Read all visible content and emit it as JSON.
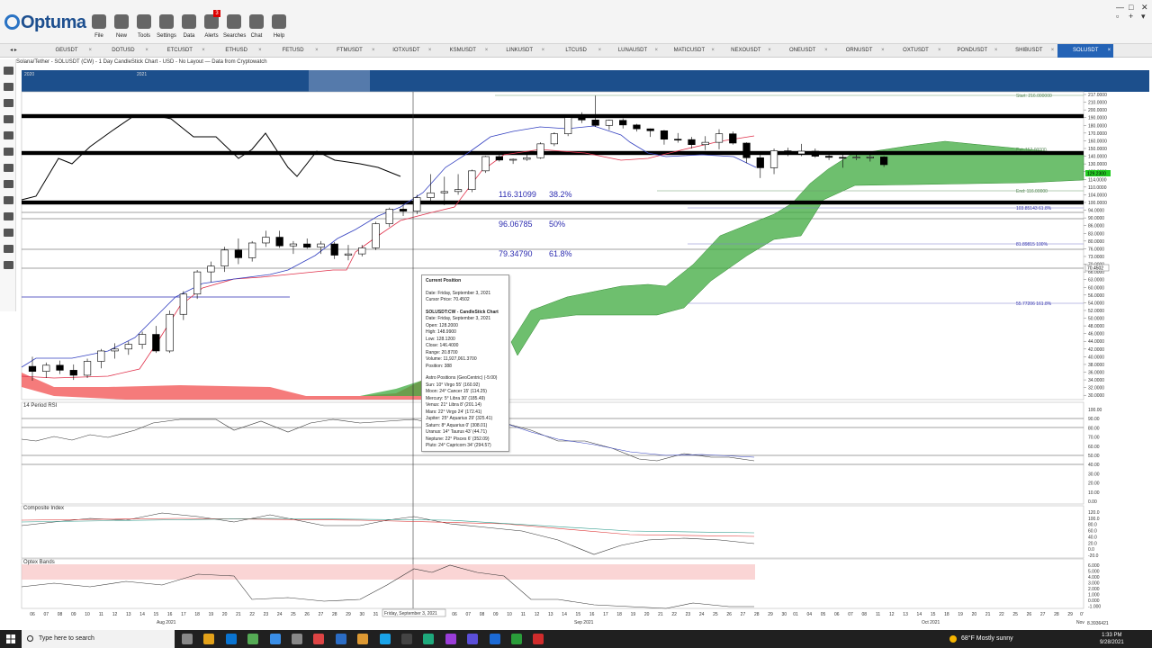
{
  "app": {
    "logo_text": "Optuma",
    "toolbar": [
      {
        "label": "File",
        "icon": "folder-icon"
      },
      {
        "label": "New",
        "icon": "new-document-icon"
      },
      {
        "label": "Tools",
        "icon": "tools-icon"
      },
      {
        "label": "Settings",
        "icon": "gear-icon"
      },
      {
        "label": "Data",
        "icon": "data-icon"
      },
      {
        "label": "Alerts",
        "icon": "alarm-icon",
        "badge": "3"
      },
      {
        "label": "Searches",
        "icon": "search-icon"
      },
      {
        "label": "Chat",
        "icon": "chat-icon"
      },
      {
        "label": "Help",
        "icon": "help-icon"
      }
    ],
    "window_controls": [
      "—",
      "□",
      "✕",
      "▫",
      "+",
      "▾"
    ]
  },
  "tabs": [
    "GEUSDT",
    "DOTUSD",
    "ETCUSDT",
    "ETHUSD",
    "FETUSD",
    "FTMUSDT",
    "IOTXUSDT",
    "KSMUSDT",
    "LINKUSDT",
    "LTCUSD",
    "LUNAUSDT",
    "MATICUSDT",
    "NEXOUSDT",
    "ONEUSDT",
    "ORNUSDT",
    "OXTUSDT",
    "PONDUSDT",
    "SHIBUSDT",
    "SOLUSDT"
  ],
  "active_tab": "SOLUSDT",
  "chart_title": "Solana/Tether - SOLUSDT (CW) - 1 Day CandleStick Chart - USD - No Layout — Data from Cryptowatch",
  "navigator_labels": [
    "2020",
    "2021"
  ],
  "chart_data": {
    "type": "candlestick",
    "candles": [
      [
        37.5,
        40.0,
        33.8,
        36.2
      ],
      [
        36.2,
        38.5,
        34.5,
        37.8
      ],
      [
        37.8,
        39.0,
        35.5,
        36.5
      ],
      [
        36.5,
        38.0,
        34.0,
        35.2
      ],
      [
        35.2,
        39.5,
        34.5,
        38.8
      ],
      [
        38.8,
        42.0,
        37.0,
        41.5
      ],
      [
        41.5,
        43.5,
        39.5,
        42.0
      ],
      [
        42.0,
        44.0,
        40.5,
        43.2
      ],
      [
        43.2,
        46.5,
        42.0,
        45.8
      ],
      [
        45.8,
        48.0,
        41.0,
        41.5
      ],
      [
        41.5,
        52.0,
        41.0,
        51.0
      ],
      [
        51.0,
        58.0,
        49.5,
        56.5
      ],
      [
        56.5,
        67.0,
        55.0,
        66.0
      ],
      [
        66.0,
        71.0,
        62.0,
        69.0
      ],
      [
        69.0,
        77.0,
        66.0,
        75.5
      ],
      [
        75.5,
        81.0,
        70.0,
        72.5
      ],
      [
        72.5,
        80.0,
        71.0,
        79.0
      ],
      [
        79.0,
        84.0,
        77.0,
        81.5
      ],
      [
        81.5,
        84.0,
        76.5,
        77.5
      ],
      [
        77.5,
        80.0,
        74.0,
        78.5
      ],
      [
        78.5,
        81.0,
        76.0,
        76.8
      ],
      [
        76.8,
        80.0,
        74.0,
        78.5
      ],
      [
        78.5,
        79.5,
        72.0,
        73.5
      ],
      [
        73.5,
        78.0,
        71.5,
        74.0
      ],
      [
        74.0,
        78.0,
        73.0,
        76.5
      ],
      [
        76.5,
        88.0,
        75.5,
        87.0
      ],
      [
        87.0,
        96.0,
        85.5,
        94.8
      ],
      [
        94.8,
        98.0,
        91.0,
        93.5
      ],
      [
        93.5,
        104.0,
        92.0,
        102.5
      ],
      [
        102.5,
        118.0,
        100.5,
        105.5
      ],
      [
        105.5,
        116.0,
        98.0,
        106.5
      ],
      [
        106.5,
        118.0,
        104.0,
        108.0
      ],
      [
        108.0,
        122.5,
        106.0,
        121.0
      ],
      [
        121.0,
        140.5,
        119.0,
        139.5
      ],
      [
        139.5,
        142.0,
        133.0,
        135.0
      ],
      [
        135.0,
        137.0,
        130.0,
        136.0
      ],
      [
        136.0,
        145.5,
        134.0,
        138.0
      ],
      [
        138.0,
        158.0,
        136.5,
        156.0
      ],
      [
        156.0,
        171.0,
        153.0,
        169.0
      ],
      [
        169.0,
        193.0,
        166.0,
        190.0
      ],
      [
        190.0,
        197.0,
        183.0,
        187.0
      ],
      [
        187.0,
        216.0,
        178.0,
        180.0
      ],
      [
        180.0,
        187.5,
        174.0,
        186.5
      ],
      [
        186.5,
        189.0,
        176.0,
        180.5
      ],
      [
        180.5,
        182.0,
        172.0,
        175.5
      ],
      [
        175.5,
        176.0,
        165.0,
        173.0
      ],
      [
        173.0,
        174.0,
        155.0,
        162.0
      ],
      [
        162.0,
        170.0,
        157.5,
        161.5
      ],
      [
        161.5,
        165.0,
        150.0,
        155.0
      ],
      [
        155.0,
        166.0,
        148.0,
        158.0
      ],
      [
        158.0,
        175.0,
        149.0,
        169.0
      ],
      [
        169.0,
        172.0,
        155.0,
        157.0
      ],
      [
        157.0,
        158.0,
        131.0,
        138.0
      ],
      [
        138.0,
        144.0,
        115.0,
        125.0
      ],
      [
        125.0,
        150.0,
        118.0,
        147.0
      ],
      [
        147.0,
        151.0,
        140.0,
        143.0
      ],
      [
        143.0,
        156.0,
        140.0,
        146.5
      ],
      [
        146.5,
        150.0,
        138.0,
        140.0
      ],
      [
        140.0,
        145.0,
        135.0,
        138.5
      ],
      [
        138.5,
        145.0,
        125.0,
        138.0
      ],
      [
        138.0,
        144.0,
        135.0,
        138.8
      ],
      [
        138.8,
        143.0,
        133.0,
        139.0
      ],
      [
        139.0,
        140.0,
        126.0,
        129.0
      ]
    ],
    "price_axis": [
      "217.0000",
      "210.0000",
      "200.0000",
      "190.0000",
      "180.0000",
      "170.0000",
      "160.0000",
      "150.0000",
      "140.0000",
      "130.0000",
      "120.0000",
      "114.0000",
      "110.0000",
      "104.0000",
      "100.0000",
      "94.0000",
      "90.0000",
      "86.0000",
      "83.0000",
      "80.0000",
      "76.0000",
      "73.0000",
      "70.0000",
      "66.0000",
      "63.0000",
      "60.0000",
      "56.0000",
      "54.0000",
      "52.0000",
      "50.0000",
      "48.0000",
      "46.0000",
      "44.0000",
      "42.0000",
      "40.0000",
      "38.0000",
      "36.0000",
      "34.0000",
      "32.0000",
      "30.0000"
    ],
    "current_price_label": "129.2300",
    "cursor_price_label": "70.4502",
    "fib_labels": [
      {
        "price": 116.31099,
        "text": "116.31099",
        "pct": "38.2%"
      },
      {
        "price": 96.06785,
        "text": "96.06785",
        "pct": "50%"
      },
      {
        "price": 79.3479,
        "text": "79.34790",
        "pct": "61.8%"
      }
    ],
    "ext_labels": [
      {
        "price": 216.0,
        "text": "Start: 216.000000"
      },
      {
        "price": 148.0,
        "text": "Ext: 152.00000"
      },
      {
        "price": 116.0,
        "text": "End: 116.00000"
      },
      {
        "price": 103.85143,
        "text": "103.85143   61.8%"
      },
      {
        "price": 81.89815,
        "text": "81.89815   100%"
      },
      {
        "price": 55.77206,
        "text": "55.77206   161.8%"
      }
    ],
    "x_days_aug": [
      "06",
      "07",
      "08",
      "09",
      "10",
      "11",
      "12",
      "13",
      "14",
      "15",
      "16",
      "17",
      "18",
      "19",
      "20",
      "21",
      "22",
      "23",
      "24",
      "25",
      "26",
      "27",
      "28",
      "29",
      "30",
      "31"
    ],
    "x_days_sep": [
      "06",
      "07",
      "08",
      "09",
      "10",
      "11",
      "12",
      "13",
      "14",
      "15",
      "16",
      "17",
      "18",
      "19",
      "20",
      "21",
      "22",
      "23",
      "24",
      "25",
      "26",
      "27",
      "28",
      "29",
      "30"
    ],
    "x_days_oct": [
      "01",
      "04",
      "05",
      "06",
      "07",
      "08",
      "11",
      "12",
      "13",
      "14",
      "15",
      "18",
      "19",
      "20",
      "21",
      "22",
      "25",
      "26",
      "27",
      "28",
      "29"
    ],
    "x_day_last": "0'",
    "month_labels": [
      "Aug 2021",
      "Sep 2021",
      "Oct 2021",
      "Nov"
    ],
    "cursor_date_label": "Friday, September 3, 2021",
    "rsi_label": "14 Period RSI",
    "rsi_axis": [
      "100.00",
      "90.00",
      "80.00",
      "70.00",
      "60.00",
      "50.00",
      "40.00",
      "30.00",
      "20.00",
      "10.00",
      "0.00"
    ],
    "composite_label": "Composite Index",
    "composite_axis": [
      "120.0",
      "100.0",
      "80.0",
      "60.0",
      "40.0",
      "20.0",
      "0.0",
      "-20.0"
    ],
    "optex_label": "Optex Bands",
    "optex_axis": [
      "6.000",
      "5.000",
      "4.000",
      "3.000",
      "2.000",
      "1.000",
      "0.000",
      "-1.000"
    ],
    "bottom_right_label": "8.3936421"
  },
  "tooltip": {
    "title": "Current Position",
    "date_line": "Date: Friday, September 3, 2021",
    "cursor_line": "Cursor Price: 70.4502",
    "section": "SOLUSDT:CW - CandleStick Chart",
    "lines": [
      "Date: Friday, September 3, 2021",
      "Open: 128.2000",
      "High: 148.9900",
      "Low: 128.1200",
      "Close: 146.4000",
      "Range: 20.8700",
      "Volume: 11,927,061.3700",
      "Position: 388"
    ],
    "astro_title": "Astro Positions (GeoCentric) (-5:00)",
    "astro": [
      "Sun: 10° Virgo 55' (160.92)",
      "Moon: 24° Cancer 15' (114.25)",
      "Mercury: 5° Libra 30' (185.49)",
      "Venus: 21° Libra 8' (201.14)",
      "Mars: 22° Virgo 24' (172.41)",
      "Jupiter: 25° Aquarius 29' (325.41)",
      "Saturn: 8° Aquarius 0' (308.01)",
      "Uranus: 14° Taurus 43' (44.71)",
      "Neptune: 22° Pisces 6' (352.09)",
      "Pluto: 24° Capricorn 34' (294.57)"
    ]
  },
  "taskbar": {
    "search_placeholder": "Type here to search",
    "weather": "68°F  Mostly sunny",
    "time": "1:33 PM",
    "date": "9/28/2021"
  }
}
